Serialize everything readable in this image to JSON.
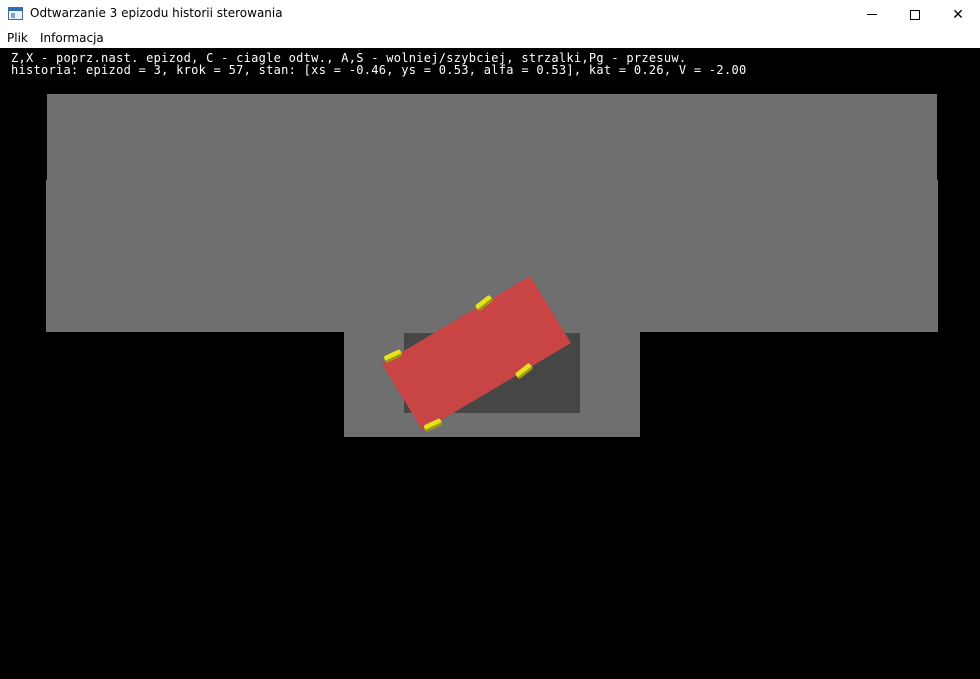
{
  "window": {
    "title": "Odtwarzanie 3 epizodu historii sterowania",
    "controls": {
      "close_glyph": "✕"
    }
  },
  "menu": {
    "items": [
      "Plik",
      "Informacja"
    ]
  },
  "overlay": {
    "line1": "Z,X - poprz.nast. epizod, C - ciagle odtw., A,S - wolniej/szybciej, strzalki,Pg - przesuw.",
    "line2": "historia: epizod = 3, krok = 57, stan: [xs = -0.46, ys = 0.53, alfa = 0.53], kat = 0.26, V = -2.00"
  },
  "scene": {
    "colors": {
      "background": "#000000",
      "road": "#6f6f6f",
      "parking_slot": "#464646",
      "car_body": "#c94444",
      "wheel": "#e6e21a",
      "wheel_shadow": "#9a9a10",
      "text": "#ffffff"
    }
  }
}
